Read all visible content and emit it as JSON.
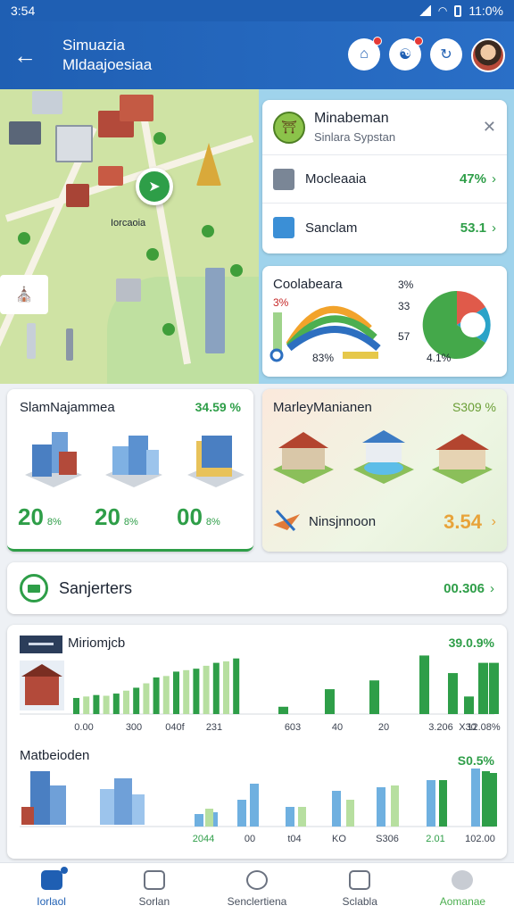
{
  "status": {
    "time": "3:54",
    "battery": "11:0%"
  },
  "appbar": {
    "back_icon": "arrow-left-icon",
    "title_line1": "Simuazia",
    "title_line2": "Mldaajoesiaa",
    "action_icons": [
      "home-alert-icon",
      "network-alert-icon",
      "sync-icon"
    ],
    "avatar": "user-avatar"
  },
  "map": {
    "pin_icon": "navigation-pin-icon",
    "label": "Iorcaoia"
  },
  "popup": {
    "title": "Minabeman",
    "subtitle": "Sinlara Sypstan",
    "rows": [
      {
        "label": "Mocleaaia",
        "value": "47%",
        "icon_color": "#7a8696"
      },
      {
        "label": "Sanclam",
        "value": "53.1",
        "icon_color": "#3b8fd6"
      }
    ]
  },
  "collab": {
    "title": "Coolabeara",
    "left_top": "3%",
    "left_bottom": "83%",
    "right_top": "3%",
    "right_mid": "33",
    "right_low": "57",
    "right_bottom": "4.1%"
  },
  "stat": {
    "title": "SlamNajammea",
    "value": "34.59 %",
    "numbers": [
      {
        "n": "20",
        "u": "8%"
      },
      {
        "n": "20",
        "u": "8%"
      },
      {
        "n": "00",
        "u": "8%"
      }
    ]
  },
  "money": {
    "title": "MarleyManianen",
    "value": "S309 %",
    "sub_label": "Ninsjnnoon",
    "sub_value": "3.54"
  },
  "summary": {
    "title": "Sanjerters",
    "value": "00.306"
  },
  "chart_data": [
    {
      "type": "bar",
      "title": "Miriomjcb",
      "value": "39.0.9%",
      "x_labels": [
        "0.00",
        "300",
        "040f",
        "231",
        "603",
        "40",
        "20",
        "3.206",
        "X30",
        "12.08%"
      ],
      "series": [
        {
          "values": [
            0.22,
            0.24,
            0.26,
            0.25,
            0.28,
            0.32,
            0.36,
            0.42,
            0.5,
            0.52,
            0.58,
            0.6,
            0.62,
            0.66,
            0.7,
            0.72,
            0.76
          ]
        },
        {
          "values": [
            0.1,
            0.34,
            0.46,
            0.8,
            0.56,
            0.24,
            0.7,
            0.7
          ]
        }
      ]
    },
    {
      "type": "bar",
      "title": "Matbeioden",
      "value": "S0.5%",
      "x_labels": [
        "2044",
        "00",
        "t04",
        "KO",
        "S306",
        "2.01",
        "102.00"
      ],
      "series": [
        {
          "values": [
            0.14,
            0.16,
            0.3,
            0.48,
            0.22,
            0.4,
            0.44,
            0.52,
            0.65
          ]
        },
        {
          "values": [
            0.2,
            0.22,
            0.3,
            0.46,
            0.52,
            0.62,
            0.6
          ]
        }
      ]
    }
  ],
  "nav": [
    {
      "label": "Iorlaol",
      "icon": "home-icon"
    },
    {
      "label": "Sorlan",
      "icon": "calendar-icon"
    },
    {
      "label": "Senclertiena",
      "icon": "search-icon"
    },
    {
      "label": "Sclabla",
      "icon": "chart-icon"
    },
    {
      "label": "Aomanae",
      "icon": "profile-icon"
    }
  ],
  "colors": {
    "primary": "#1f5fb3",
    "accent_green": "#2e9e48",
    "light_green": "#b7dfa0",
    "blue_bar": "#6fb0e0"
  }
}
